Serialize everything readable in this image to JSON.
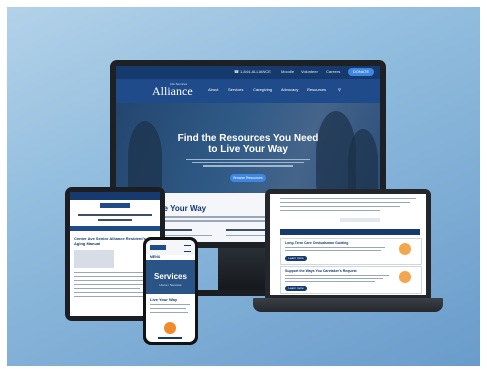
{
  "monitor": {
    "utility": {
      "phone": "1-844-ALLIANCE",
      "items": [
        "Moodle",
        "Volunteer",
        "Careers"
      ],
      "donate_label": "DONATE"
    },
    "brand": {
      "logo": "Alliance",
      "tagline": "Life Services"
    },
    "nav": [
      "About",
      "Services",
      "Caregiving",
      "Advocacy",
      "Resources"
    ],
    "hero": {
      "title_line1": "Find the Resources You Need",
      "title_line2": "to Live Your Way",
      "button_label": "Browse Resources"
    },
    "section_title": "Live Your Way"
  },
  "tablet": {
    "page_title": "Center Ave Senior Alliance Resident's Aging Manual"
  },
  "phone": {
    "header_label": "MENU",
    "hero_title": "Services",
    "hero_subtitle": "Home / Services",
    "section_title": "Live Your Way"
  },
  "laptop": {
    "card1_title": "Long-Term Care Ombudsman Guiding",
    "card2_title": "Support the Ways You Caretaker's Request",
    "button_label": "Learn more"
  },
  "colors": {
    "brand_navy": "#163a6e",
    "accent_blue": "#3f86e0",
    "accent_orange": "#f3a64f"
  }
}
